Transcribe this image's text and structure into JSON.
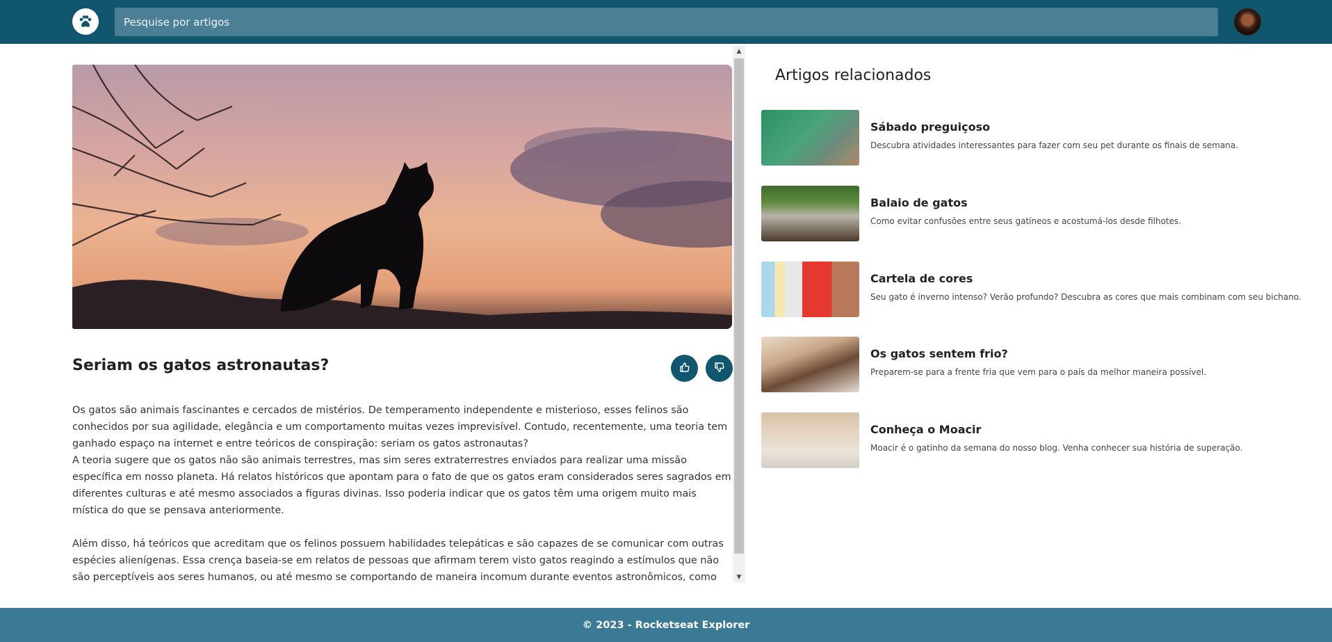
{
  "header": {
    "logo_icon": "paw-icon",
    "search_placeholder": "Pesquise por artigos"
  },
  "article": {
    "title": "Seriam os gatos astronautas?",
    "like_icon": "thumbs-up-icon",
    "dislike_icon": "thumbs-down-icon",
    "paragraphs": [
      "Os gatos são animais fascinantes e cercados de mistérios. De temperamento independente e misterioso, esses felinos são conhecidos por sua agilidade, elegância e um comportamento muitas vezes imprevisível. Contudo, recentemente, uma teoria tem ganhado espaço na internet e entre teóricos de conspiração: seriam os gatos astronautas?",
      "A teoria sugere que os gatos não são animais terrestres, mas sim seres extraterrestres enviados para realizar uma missão específica em nosso planeta. Há relatos históricos que apontam para o fato de que os gatos eram considerados seres sagrados em diferentes culturas e até mesmo associados a figuras divinas. Isso poderia indicar que os gatos têm uma origem muito mais mística do que se pensava anteriormente.",
      "Além disso, há teóricos que acreditam que os felinos possuem habilidades telepáticas e são capazes de se comunicar com outras espécies alienígenas. Essa crença baseia-se em relatos de pessoas que afirmam terem visto gatos reagindo a estímulos que não são perceptíveis aos seres humanos, ou até mesmo se comportando de maneira incomum durante eventos astronômicos, como uma aurora"
    ]
  },
  "related": {
    "title": "Artigos relacionados",
    "items": [
      {
        "name": "Sábado preguiçoso",
        "desc": "Descubra atividades interessantes para fazer com seu pet durante os finais de semana."
      },
      {
        "name": "Balaio de gatos",
        "desc": "Como evitar confusões entre seus gatíneos e acostumá-los desde filhotes."
      },
      {
        "name": "Cartela de cores",
        "desc": "Seu gato é inverno intenso? Verão profundo? Descubra as cores que mais combinam com seu bichano."
      },
      {
        "name": "Os gatos sentem frio?",
        "desc": "Preparem-se para a frente fria que vem para o país da melhor maneira possível."
      },
      {
        "name": "Conheça o Moacir",
        "desc": "Moacir é o gatinho da semana do nosso blog. Venha conhecer sua história de superação."
      }
    ]
  },
  "footer": {
    "text": "© 2023 - Rocketseat Explorer"
  }
}
